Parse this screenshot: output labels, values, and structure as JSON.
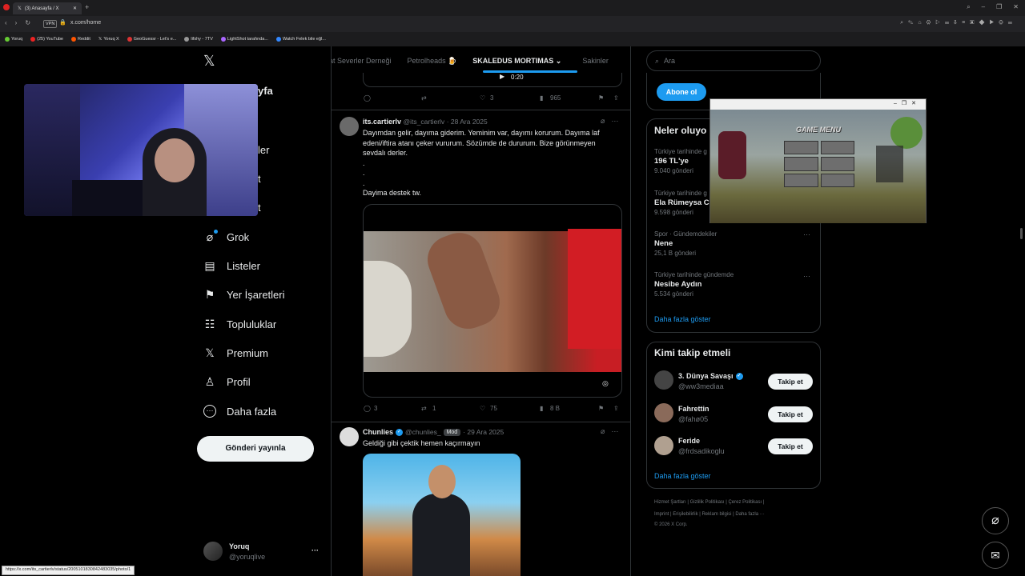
{
  "browser": {
    "tab_title": "(3) Anasayfa / X",
    "url": "x.com/home",
    "vpn_label": "VPN",
    "bookmarks": [
      "Yoruq",
      "(25) YouTube",
      "Reddit",
      "Yoruq X",
      "GeoGuessr - Let's e...",
      "lifshy - 7TV",
      "LightShot tarafında...",
      "Watch Felek bile eğl..."
    ]
  },
  "stream": {
    "logo": "𝕏",
    "peek_title": "yfa",
    "peek_items": [
      "ler",
      "t",
      "t"
    ]
  },
  "nav": {
    "items": [
      {
        "icon": "grok-icon",
        "glyph": "⌀",
        "label": "Grok"
      },
      {
        "icon": "lists-icon",
        "glyph": "▤",
        "label": "Listeler"
      },
      {
        "icon": "bookmark-icon",
        "glyph": "⚑",
        "label": "Yer İşaretleri"
      },
      {
        "icon": "communities-icon",
        "glyph": "☷",
        "label": "Topluluklar"
      },
      {
        "icon": "premium-icon",
        "glyph": "𝕏",
        "label": "Premium"
      },
      {
        "icon": "profile-icon",
        "glyph": "♙",
        "label": "Profil"
      },
      {
        "icon": "more-icon",
        "glyph": "⋯",
        "label": "Daha fazla"
      }
    ],
    "post_button": "Gönderi yayınla",
    "account_name": "Yoruq",
    "account_handle": "@yoruqlive",
    "account_more": "···"
  },
  "timeline": {
    "tabs": [
      {
        "label": "at Severler Derneği",
        "active": false
      },
      {
        "label": "Petrolheads 🍺",
        "active": false
      },
      {
        "label": "SKALEDUS MORTIMAS ⌄",
        "active": true
      },
      {
        "label": "Sakinler",
        "active": false
      }
    ],
    "video_time": "0:20",
    "top_actions": {
      "replies": "",
      "retweets": "",
      "likes": "3",
      "views": "965"
    },
    "tweet1": {
      "name": "its.cartierlv",
      "handle": "@its_cartierlv",
      "date": "· 28 Ara 2025",
      "text_lines": [
        "Dayımdan gelir, dayıma giderim. Yeminim var, dayımı korurum. Dayıma laf",
        "edeni/iftira atanı çeker vururum. Sözümde de dururum. Bize görünmeyen",
        "sevdalı derler.",
        ".",
        ".",
        ".",
        "Dayima destek tw."
      ],
      "replies": "3",
      "retweets": "1",
      "likes": "75",
      "views": "8 B"
    },
    "tweet2": {
      "name": "Chunlies",
      "handle": "@chunlies_",
      "badge": "Mod",
      "date": "· 29 Ara 2025",
      "text": "Geldiği gibi çektik hemen kaçırmayın"
    }
  },
  "right": {
    "search_placeholder": "Ara",
    "subscribe_button": "Abone ol",
    "trends_title": "Neler oluyo",
    "trends": [
      {
        "context": "Türkiye tarihinde g",
        "name": "196 TL'ye",
        "count": "9.040 gönderi"
      },
      {
        "context": "Türkiye tarihinde g",
        "name": "Ela Rümeysa Ce",
        "count": "9.598 gönderi"
      },
      {
        "context": "Spor · Gündemdekiler",
        "name": "Nene",
        "count": "25,1 B gönderi"
      },
      {
        "context": "Türkiye tarihinde gündemde",
        "name": "Nesibe Aydın",
        "count": "5.534 gönderi"
      }
    ],
    "trends_more": "Daha fazla göster",
    "follow_title": "Kimi takip etmeli",
    "follow": [
      {
        "name": "3. Dünya Savaşı",
        "handle": "@ww3mediaa",
        "button": "Takip et",
        "verified": true
      },
      {
        "name": "Fahrettin",
        "handle": "@fahø05",
        "button": "Takip et",
        "verified": false
      },
      {
        "name": "Feride",
        "handle": "@frdsadikoglu",
        "button": "Takip et",
        "verified": false
      }
    ],
    "follow_more": "Daha fazla göster",
    "footer_line1": "Hizmet Şartları  |  Gizlilik Politikası  |  Çerez Politikası  |",
    "footer_line2": "Imprint  |  Erişilebilirlik  |  Reklam bilgisi  |  Daha fazla ···",
    "footer_line3": "© 2026 X Corp."
  },
  "game_window": {
    "menu_title": "GAME MENU"
  },
  "status_url": "https://x.com/its_cartierlv/status/2005101830842483035/photo/1",
  "colors": {
    "accent": "#1d9bf0",
    "background": "#000000",
    "border": "#2f3336"
  }
}
